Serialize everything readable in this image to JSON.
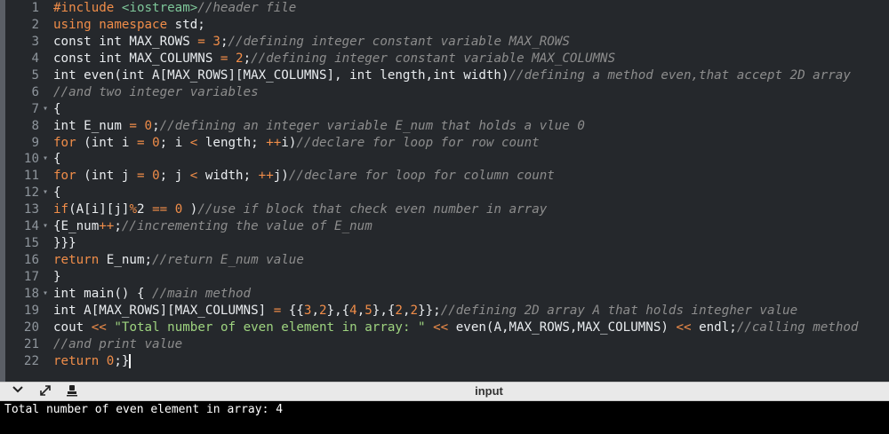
{
  "editor": {
    "lines": [
      {
        "n": "1",
        "fold": "",
        "segs": [
          {
            "t": "#include ",
            "c": "kw"
          },
          {
            "t": "<iostream>",
            "c": "inc"
          },
          {
            "t": "//header file",
            "c": "cm"
          }
        ]
      },
      {
        "n": "2",
        "fold": "",
        "segs": [
          {
            "t": "using namespace",
            "c": "kw"
          },
          {
            "t": " std;",
            "c": ""
          }
        ]
      },
      {
        "n": "3",
        "fold": "",
        "segs": [
          {
            "t": "const int MAX_ROWS ",
            "c": ""
          },
          {
            "t": "=",
            "c": "op"
          },
          {
            "t": " ",
            "c": ""
          },
          {
            "t": "3",
            "c": "num"
          },
          {
            "t": ";",
            "c": ""
          },
          {
            "t": "//defining integer constant variable MAX_ROWS",
            "c": "cm"
          }
        ]
      },
      {
        "n": "4",
        "fold": "",
        "segs": [
          {
            "t": "const int MAX_COLUMNS ",
            "c": ""
          },
          {
            "t": "=",
            "c": "op"
          },
          {
            "t": " ",
            "c": ""
          },
          {
            "t": "2",
            "c": "num"
          },
          {
            "t": ";",
            "c": ""
          },
          {
            "t": "//defining integer constant variable MAX_COLUMNS",
            "c": "cm"
          }
        ]
      },
      {
        "n": "5",
        "fold": "",
        "segs": [
          {
            "t": "int even(int A[MAX_ROWS][MAX_COLUMNS], int length,int width)",
            "c": ""
          },
          {
            "t": "//defining a method even,that accept 2D array",
            "c": "cm"
          }
        ]
      },
      {
        "n": "6",
        "fold": "",
        "segs": [
          {
            "t": "//and two integer variables",
            "c": "cm"
          }
        ]
      },
      {
        "n": "7",
        "fold": "▾",
        "segs": [
          {
            "t": "{",
            "c": ""
          }
        ]
      },
      {
        "n": "8",
        "fold": "",
        "segs": [
          {
            "t": "int E_num ",
            "c": ""
          },
          {
            "t": "=",
            "c": "op"
          },
          {
            "t": " ",
            "c": ""
          },
          {
            "t": "0",
            "c": "num"
          },
          {
            "t": ";",
            "c": ""
          },
          {
            "t": "//defining an integer variable E_num that holds a vlue 0",
            "c": "cm"
          }
        ]
      },
      {
        "n": "9",
        "fold": "",
        "segs": [
          {
            "t": "for",
            "c": "kw"
          },
          {
            "t": " (int i ",
            "c": ""
          },
          {
            "t": "=",
            "c": "op"
          },
          {
            "t": " ",
            "c": ""
          },
          {
            "t": "0",
            "c": "num"
          },
          {
            "t": "; i ",
            "c": ""
          },
          {
            "t": "<",
            "c": "op"
          },
          {
            "t": " length; ",
            "c": ""
          },
          {
            "t": "++",
            "c": "op"
          },
          {
            "t": "i)",
            "c": ""
          },
          {
            "t": "//declare for loop for row count",
            "c": "cm"
          }
        ]
      },
      {
        "n": "10",
        "fold": "▾",
        "segs": [
          {
            "t": "{",
            "c": ""
          }
        ]
      },
      {
        "n": "11",
        "fold": "",
        "segs": [
          {
            "t": "for",
            "c": "kw"
          },
          {
            "t": " (int j ",
            "c": ""
          },
          {
            "t": "=",
            "c": "op"
          },
          {
            "t": " ",
            "c": ""
          },
          {
            "t": "0",
            "c": "num"
          },
          {
            "t": "; j ",
            "c": ""
          },
          {
            "t": "<",
            "c": "op"
          },
          {
            "t": " width; ",
            "c": ""
          },
          {
            "t": "++",
            "c": "op"
          },
          {
            "t": "j)",
            "c": ""
          },
          {
            "t": "//declare for loop for column count",
            "c": "cm"
          }
        ]
      },
      {
        "n": "12",
        "fold": "▾",
        "segs": [
          {
            "t": "{",
            "c": ""
          }
        ]
      },
      {
        "n": "13",
        "fold": "",
        "segs": [
          {
            "t": "if",
            "c": "kw"
          },
          {
            "t": "(A[i][j]",
            "c": ""
          },
          {
            "t": "%",
            "c": "op"
          },
          {
            "t": "2 ",
            "c": ""
          },
          {
            "t": "==",
            "c": "op"
          },
          {
            "t": " ",
            "c": ""
          },
          {
            "t": "0",
            "c": "num"
          },
          {
            "t": " )",
            "c": ""
          },
          {
            "t": "//use if block that check even number in array",
            "c": "cm"
          }
        ]
      },
      {
        "n": "14",
        "fold": "▾",
        "segs": [
          {
            "t": "{E_num",
            "c": ""
          },
          {
            "t": "++",
            "c": "op"
          },
          {
            "t": ";",
            "c": ""
          },
          {
            "t": "//incrementing the value of E_num",
            "c": "cm"
          }
        ]
      },
      {
        "n": "15",
        "fold": "",
        "segs": [
          {
            "t": "}}}",
            "c": ""
          }
        ]
      },
      {
        "n": "16",
        "fold": "",
        "segs": [
          {
            "t": "return",
            "c": "kw"
          },
          {
            "t": " E_num;",
            "c": ""
          },
          {
            "t": "//return E_num value",
            "c": "cm"
          }
        ]
      },
      {
        "n": "17",
        "fold": "",
        "segs": [
          {
            "t": "}",
            "c": ""
          }
        ]
      },
      {
        "n": "18",
        "fold": "▾",
        "segs": [
          {
            "t": "int main() { ",
            "c": ""
          },
          {
            "t": "//main method",
            "c": "cm"
          }
        ]
      },
      {
        "n": "19",
        "fold": "",
        "segs": [
          {
            "t": "int A[MAX_ROWS][MAX_COLUMNS] ",
            "c": ""
          },
          {
            "t": "=",
            "c": "op"
          },
          {
            "t": " {{",
            "c": ""
          },
          {
            "t": "3",
            "c": "num"
          },
          {
            "t": ",",
            "c": ""
          },
          {
            "t": "2",
            "c": "num"
          },
          {
            "t": "},{",
            "c": ""
          },
          {
            "t": "4",
            "c": "num"
          },
          {
            "t": ",",
            "c": ""
          },
          {
            "t": "5",
            "c": "num"
          },
          {
            "t": "},{",
            "c": ""
          },
          {
            "t": "2",
            "c": "num"
          },
          {
            "t": ",",
            "c": ""
          },
          {
            "t": "2",
            "c": "num"
          },
          {
            "t": "}};",
            "c": ""
          },
          {
            "t": "//defining 2D array A that holds integher value",
            "c": "cm"
          }
        ]
      },
      {
        "n": "20",
        "fold": "",
        "segs": [
          {
            "t": "cout ",
            "c": ""
          },
          {
            "t": "<<",
            "c": "op"
          },
          {
            "t": " ",
            "c": ""
          },
          {
            "t": "\"Total number of even element in array: \"",
            "c": "str"
          },
          {
            "t": " ",
            "c": ""
          },
          {
            "t": "<<",
            "c": "op"
          },
          {
            "t": " even(A,MAX_ROWS,MAX_COLUMNS) ",
            "c": ""
          },
          {
            "t": "<<",
            "c": "op"
          },
          {
            "t": " endl;",
            "c": ""
          },
          {
            "t": "//calling method",
            "c": "cm"
          }
        ]
      },
      {
        "n": "21",
        "fold": "",
        "segs": [
          {
            "t": "//and print value",
            "c": "cm"
          }
        ]
      },
      {
        "n": "22",
        "fold": "",
        "segs": [
          {
            "t": "return",
            "c": "kw"
          },
          {
            "t": " ",
            "c": ""
          },
          {
            "t": "0",
            "c": "num"
          },
          {
            "t": ";}",
            "c": ""
          }
        ]
      }
    ]
  },
  "panel": {
    "title": "input",
    "icons": [
      "chevron-down-icon",
      "expand-icon",
      "stamp-icon"
    ]
  },
  "console": {
    "output": "Total number of even element in array: 4"
  }
}
